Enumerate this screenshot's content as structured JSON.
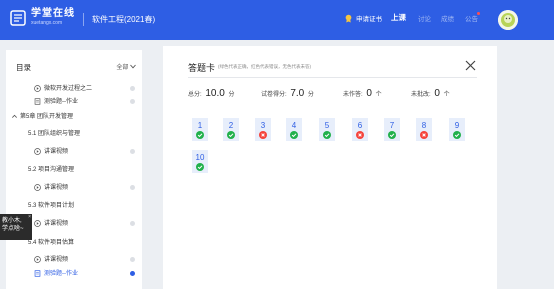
{
  "header": {
    "logo_main": "学堂在线",
    "logo_sub": "xuetangx.com",
    "course_title": "软件工程(2021春)",
    "certificate_label": "申请证书",
    "nav": [
      {
        "label": "上课",
        "active": true
      },
      {
        "label": "讨论",
        "active": false
      },
      {
        "label": "成绩",
        "active": false
      },
      {
        "label": "公告",
        "active": false
      }
    ]
  },
  "sidebar": {
    "heading": "目录",
    "filter": "全部",
    "items": [
      {
        "kind": "task",
        "icon": "play-circle-icon",
        "label": "微软开发过程之二",
        "status": "unread"
      },
      {
        "kind": "task",
        "icon": "document-icon",
        "label": "测验题--作业",
        "status": "unread"
      },
      {
        "kind": "chapter",
        "label": "第5章 团队开发管理",
        "status": "none"
      },
      {
        "kind": "section",
        "label": "5.1 团队组织与管理",
        "status": "none"
      },
      {
        "kind": "task",
        "icon": "play-circle-icon",
        "label": "讲课视频",
        "status": "unread"
      },
      {
        "kind": "section",
        "label": "5.2 项目沟通管理",
        "status": "none"
      },
      {
        "kind": "task",
        "icon": "play-circle-icon",
        "label": "讲课视频",
        "status": "unread"
      },
      {
        "kind": "section",
        "label": "5.3 软件项目计划",
        "status": "none"
      },
      {
        "kind": "task",
        "icon": "play-circle-icon",
        "label": "讲课视频",
        "status": "unread"
      },
      {
        "kind": "section",
        "label": "5.4 软件项目估算",
        "status": "none"
      },
      {
        "kind": "task",
        "icon": "play-circle-icon",
        "label": "讲课视频",
        "status": "unread"
      },
      {
        "kind": "task",
        "icon": "document-icon",
        "label": "测验题--作业",
        "status": "current"
      }
    ]
  },
  "tooltip": {
    "line1": "教小木,",
    "line2": "学点啥~",
    "close": "×"
  },
  "answer_card": {
    "title": "答题卡",
    "legend": "(绿色代表正确，红色代表错误，无色代表未答)",
    "stats": [
      {
        "label": "总分:",
        "value": "10.0",
        "unit": "分"
      },
      {
        "label": "试卷得分:",
        "value": "7.0",
        "unit": "分"
      },
      {
        "label": "未作答:",
        "value": "0",
        "unit": "个"
      },
      {
        "label": "未批改:",
        "value": "0",
        "unit": "个"
      }
    ],
    "questions": [
      {
        "number": "1",
        "result": "correct"
      },
      {
        "number": "2",
        "result": "correct"
      },
      {
        "number": "3",
        "result": "wrong"
      },
      {
        "number": "4",
        "result": "correct"
      },
      {
        "number": "5",
        "result": "correct"
      },
      {
        "number": "6",
        "result": "wrong"
      },
      {
        "number": "7",
        "result": "correct"
      },
      {
        "number": "8",
        "result": "wrong"
      },
      {
        "number": "9",
        "result": "correct"
      },
      {
        "number": "10",
        "result": "correct"
      }
    ]
  },
  "colors": {
    "brand": "#2e5ee4",
    "correct": "#22b14c",
    "wrong": "#f5433b",
    "question_bg": "#e7eefb"
  }
}
